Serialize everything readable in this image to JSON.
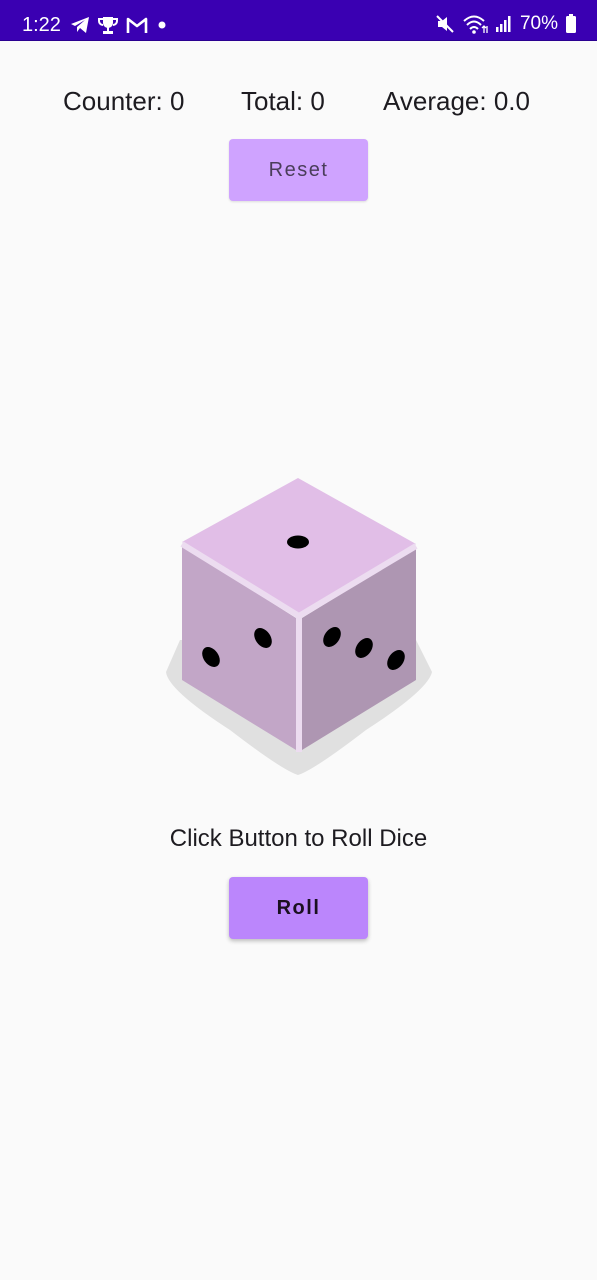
{
  "status_bar": {
    "time": "1:22",
    "left_icons": [
      "telegram-icon",
      "trophy-icon",
      "gmail-icon",
      "notification-dot-icon"
    ],
    "right_icons": [
      "mute-icon",
      "wifi-icon",
      "signal-icon",
      "battery-icon"
    ],
    "battery": "70%",
    "background": "#3a00b2"
  },
  "stats": {
    "counter": "Counter: 0",
    "total": "Total: 0",
    "average": "Average: 0.0"
  },
  "reset_button": {
    "label": "Reset",
    "color": "#cfa3ff"
  },
  "dice": {
    "icon": "dice-icon",
    "top_face_value": 1,
    "left_face_value": 2,
    "right_face_value": 3,
    "top_color": "#e1bee7",
    "left_color": "#c2a6c7",
    "right_color": "#ae96b2"
  },
  "instruction": "Click Button to Roll Dice",
  "roll_button": {
    "label": "Roll",
    "color": "#bb86fc"
  }
}
